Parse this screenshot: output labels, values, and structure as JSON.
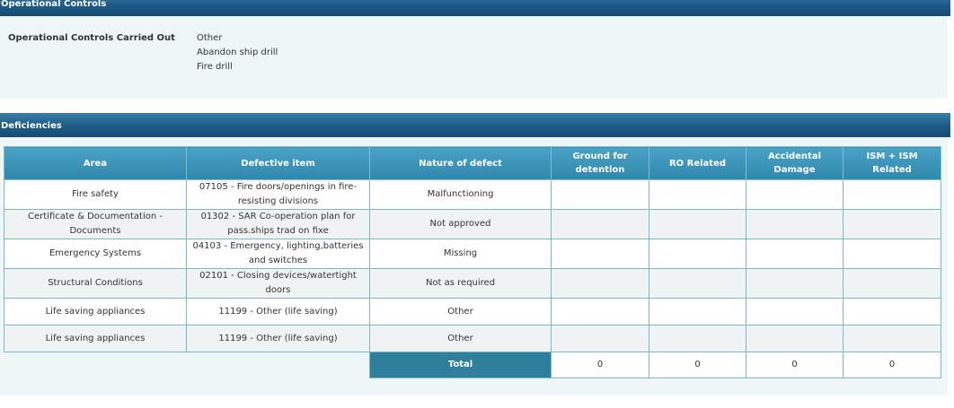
{
  "operational_controls": {
    "section_title": "Operational Controls",
    "label": "Operational Controls Carried Out",
    "values": [
      "Other",
      "Abandon ship drill",
      "Fire drill"
    ]
  },
  "deficiencies": {
    "section_title": "Deficiencies",
    "headers": [
      "Area",
      "Defective item",
      "Nature of defect",
      "Ground for detention",
      "RO Related",
      "Accidental Damage",
      "ISM + ISM Related"
    ],
    "rows": [
      {
        "area": "Fire safety",
        "item": "07105 - Fire doors/openings in fire-resisting divisions",
        "nature": "Malfunctioning"
      },
      {
        "area": "Certificate & Documentation - Documents",
        "item": "01302 - SAR Co-operation plan for pass.ships trad on fixe",
        "nature": "Not approved"
      },
      {
        "area": "Emergency Systems",
        "item": "04103 - Emergency, lighting,batteries and switches",
        "nature": "Missing"
      },
      {
        "area": "Structural Conditions",
        "item": "02101 - Closing devices/watertight doors",
        "nature": "Not as required"
      },
      {
        "area": "Life saving appliances",
        "item": "11199 - Other (life saving)",
        "nature": "Other"
      },
      {
        "area": "Life saving appliances",
        "item": "11199 - Other (life saving)",
        "nature": "Other"
      }
    ],
    "total": {
      "label": "Total",
      "ground": "0",
      "ro": "0",
      "accidental": "0",
      "ism": "0"
    }
  },
  "colors": {
    "header_dark": "#1c5a85",
    "table_header": "#3a95ba",
    "panel_bg": "#eef6f8",
    "border": "#7ab8cc"
  }
}
